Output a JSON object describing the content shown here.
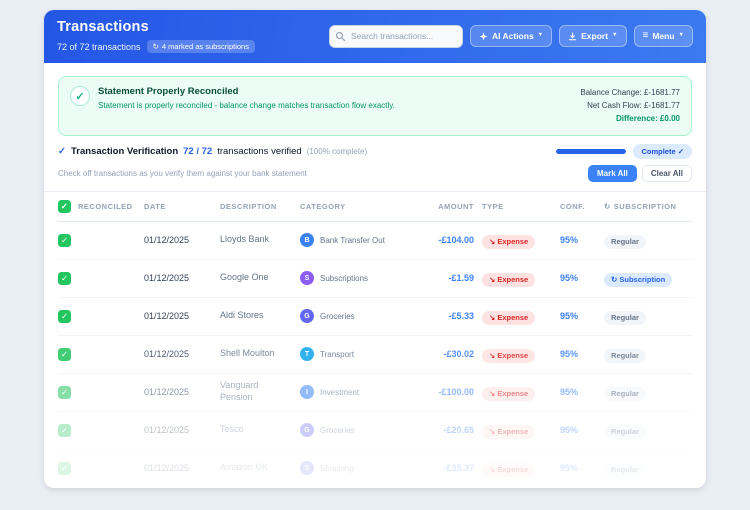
{
  "icons": {
    "check": "✓",
    "chevron_down": "▼",
    "refresh": "↻",
    "expense_arrow": "↘",
    "menu": "≡"
  },
  "colors": {
    "header_blue": "#2563eb",
    "success_green": "#10b981",
    "expense_red": "#dc2626",
    "accent_blue": "#3b82f6"
  },
  "header": {
    "title": "Transactions",
    "subtitle": "72 of 72 transactions",
    "subscriptions_badge": "4 marked as subscriptions",
    "search_placeholder": "Search transactions...",
    "ai_actions_label": "AI Actions",
    "export_label": "Export",
    "menu_label": "Menu"
  },
  "banner": {
    "title": "Statement Properly Reconciled",
    "description": "Statement is properly reconciled - balance change matches transaction flow exactly.",
    "balance_change": "Balance Change: £-1681.77",
    "net_cash_flow": "Net Cash Flow: £-1681.77",
    "difference": "Difference: £0.00"
  },
  "verification": {
    "title": "Transaction Verification",
    "count": "72 / 72",
    "count_suffix": "transactions verified",
    "completion_note": "(100% complete)",
    "progress_percent": 100,
    "complete_badge": "Complete ✓",
    "hint": "Check off transactions as you verify them against your bank statement",
    "mark_all_label": "Mark All",
    "clear_all_label": "Clear All"
  },
  "table": {
    "headers": {
      "reconciled": "RECONCILED",
      "date": "DATE",
      "description": "DESCRIPTION",
      "category": "CATEGORY",
      "amount": "AMOUNT",
      "type": "TYPE",
      "conf": "CONF.",
      "subscription": "SUBSCRIPTION"
    },
    "rows": [
      {
        "date": "01/12/2025",
        "description": "Lloyds Bank",
        "category": "Bank Transfer Out",
        "category_color": "#3b82f6",
        "amount": "-£104.00",
        "type": "Expense",
        "conf": "95%",
        "subscription": "Regular"
      },
      {
        "date": "01/12/2025",
        "description": "Google One",
        "category": "Subscriptions",
        "category_color": "#8b5cf6",
        "amount": "-£1.59",
        "type": "Expense",
        "conf": "95%",
        "subscription": "Subscription"
      },
      {
        "date": "01/12/2025",
        "description": "Aldi Stores",
        "category": "Groceries",
        "category_color": "#6366f1",
        "amount": "-£5.33",
        "type": "Expense",
        "conf": "95%",
        "subscription": "Regular"
      },
      {
        "date": "01/12/2025",
        "description": "Shell Moulton",
        "category": "Transport",
        "category_color": "#0ea5e9",
        "amount": "-£30.02",
        "type": "Expense",
        "conf": "95%",
        "subscription": "Regular"
      },
      {
        "date": "01/12/2025",
        "description": "Vanguard Pension",
        "category": "Investment",
        "category_color": "#3b82f6",
        "amount": "-£100.00",
        "type": "Expense",
        "conf": "95%",
        "subscription": "Regular"
      },
      {
        "date": "01/12/2025",
        "description": "Tesco",
        "category": "Groceries",
        "category_color": "#6366f1",
        "amount": "-£20.65",
        "type": "Expense",
        "conf": "95%",
        "subscription": "Regular"
      },
      {
        "date": "01/12/2025",
        "description": "Amazon UK",
        "category": "Shopping",
        "category_color": "#6366f1",
        "amount": "-£35.37",
        "type": "Expense",
        "conf": "95%",
        "subscription": "Regular"
      }
    ]
  }
}
